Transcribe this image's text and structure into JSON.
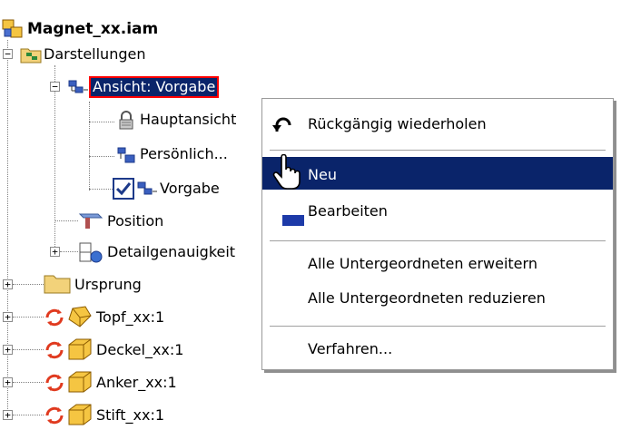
{
  "tree": {
    "root": "Magnet_xx.iam",
    "representations": "Darstellungen",
    "view_node": "Ansicht: Vorgabe",
    "view_children": [
      "Hauptansicht",
      "Persönlich...",
      "Vorgabe"
    ],
    "position": "Position",
    "detail": "Detailgenauigkeit",
    "origin": "Ursprung",
    "parts": [
      "Topf_xx:1",
      "Deckel_xx:1",
      "Anker_xx:1",
      "Stift_xx:1"
    ]
  },
  "context_menu": {
    "undo": "Rückgängig wiederholen",
    "new": "Neu",
    "edit": "Bearbeiten",
    "expand_all": "Alle Untergeordneten erweitern",
    "collapse_all": "Alle Untergeordneten reduzieren",
    "procedures": "Verfahren..."
  },
  "colors": {
    "selection": "#0a246a",
    "highlight_outline": "#ff0000",
    "folder": "#f2d27a",
    "part": "#f5c542",
    "constraint_arrow": "#e03a1f"
  }
}
